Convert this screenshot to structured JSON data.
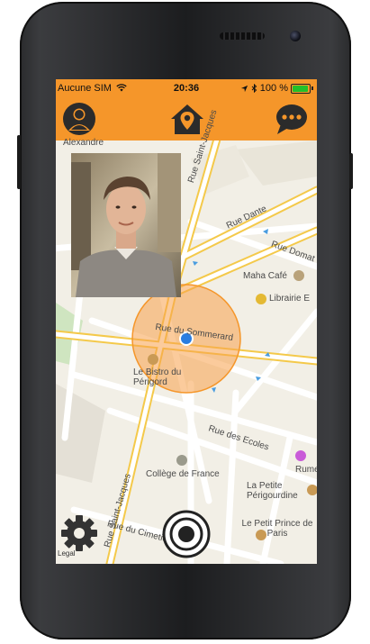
{
  "status_bar": {
    "carrier": "Aucune SIM",
    "time": "20:36",
    "battery": "100 %"
  },
  "toolbar": {
    "profile_icon": "person-icon",
    "home_icon": "home-pin-icon",
    "chat_icon": "chat-bubble-icon"
  },
  "map": {
    "labels": {
      "alexandre": "Alexandre",
      "rue_saint_jacques_top": "Rue Saint-Jacques",
      "rue_dante": "Rue Dante",
      "rue_domat": "Rue Domat",
      "maha_cafe": "Maha Café",
      "librairie": "Librairie E",
      "rue_sommerard": "Rue du Sommerard",
      "bistro": "Le Bistro du Périgord",
      "rue_saint_jacques_bottom": "Rue Saint-Jacques",
      "rue_des_ecoles": "Rue des Ecoles",
      "college": "Collège de France",
      "rumeur": "Rumeur",
      "petite_perigourdine": "La Petite Périgourdine",
      "petit_prince": "Le Petit Prince de Paris",
      "rue_cimetiere": "Rue du Cimetière"
    },
    "colors": {
      "accent": "#f5962a",
      "radius_fill": "#f7a04a",
      "user_dot": "#2a7de1"
    }
  },
  "bottom": {
    "legal": "Legal",
    "settings_icon": "gear-icon",
    "record_icon": "target-icon"
  }
}
